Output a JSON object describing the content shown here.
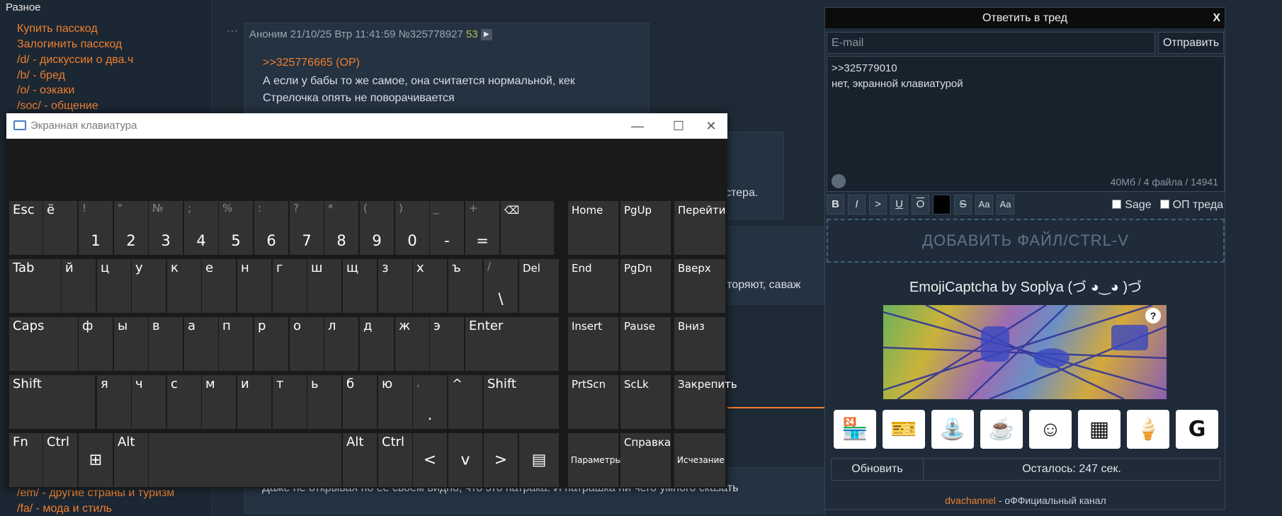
{
  "sidebar": {
    "section_title": "Разное",
    "links": [
      "Купить пасскод",
      "Залогинить пасскод",
      "/d/ - дискуссии о два.ч",
      "/b/ - бред",
      "/o/ - оэкаки",
      "/soc/ - общение"
    ],
    "bottom_links": [
      "/em/ - другие страны и туризм",
      "/fa/ - мода и стиль"
    ]
  },
  "thread": {
    "post": {
      "author": "Аноним",
      "datetime": "21/10/25 Втр 11:41:59",
      "number": "№325778927",
      "count": "53",
      "reply_ref": ">>325776665 (OP)",
      "lines": [
        "А если у бабы то же самое, она считается нормальной, кек",
        "Стрелочка опять не поворачивается"
      ]
    },
    "fragments": {
      "a": "стера.",
      "b": "вторяют, саваж",
      "c": "Даже не открывая по ее своем видно, что это патрака. И патрашка ни чего умного сказать"
    }
  },
  "reply_form": {
    "title": "Ответить в тред",
    "close_label": "X",
    "email_placeholder": "E-mail",
    "send_label": "Отправить",
    "message_lines": [
      ">>325779010",
      "нет, экранной клавиатурой"
    ],
    "meta": "40Мб / 4 файла / 14941",
    "format_buttons": [
      "B",
      "I",
      ">",
      "U",
      "O",
      "",
      "S",
      "Aa",
      "Aa"
    ],
    "sage_label": "Sage",
    "op_label": "ОП треда",
    "add_file_label": "ДОБАВИТЬ ФАЙЛ/CTRL-V",
    "captcha_title": "EmojiCaptcha by Soplya (づ ◕‿◕ )づ",
    "captcha_help": "?",
    "emoji_icons": [
      "shop-icon",
      "ticket-icon",
      "fountain-icon",
      "coffee-icon",
      "face-icon",
      "brick-wall-icon",
      "ice-cream-icon",
      "g-icon"
    ],
    "emoji_glyphs": [
      "🏪",
      "🎫",
      "⛲",
      "☕",
      "☺",
      "▦",
      "🍦",
      "G"
    ],
    "refresh_label": "Обновить",
    "remaining_label": "Осталось: 247 сек.",
    "footer_brand": "dvachannel",
    "footer_rest": " - оФФициальный канал"
  },
  "osk": {
    "title": "Экранная клавиатура",
    "row1": [
      {
        "t": "Esc"
      },
      {
        "t": "ё"
      },
      {
        "s": "!",
        "m": "1"
      },
      {
        "s": "\"",
        "m": "2"
      },
      {
        "s": "№",
        "m": "3"
      },
      {
        "s": ";",
        "m": "4"
      },
      {
        "s": "%",
        "m": "5"
      },
      {
        "s": ":",
        "m": "6"
      },
      {
        "s": "?",
        "m": "7"
      },
      {
        "s": "*",
        "m": "8"
      },
      {
        "s": "(",
        "m": "9"
      },
      {
        "s": ")",
        "m": "0"
      },
      {
        "s": "_",
        "m": "-"
      },
      {
        "s": "+",
        "m": "="
      },
      {
        "t": "⌫"
      }
    ],
    "row2": [
      "Tab",
      "й",
      "ц",
      "у",
      "к",
      "е",
      "н",
      "г",
      "ш",
      "щ",
      "з",
      "х",
      "ъ"
    ],
    "row2_extra": {
      "s": "/",
      "m": "\\",
      "del": "Del"
    },
    "row3": [
      "Caps",
      "ф",
      "ы",
      "в",
      "а",
      "п",
      "р",
      "о",
      "л",
      "д",
      "ж",
      "э",
      "Enter"
    ],
    "row4": [
      "Shift",
      "я",
      "ч",
      "с",
      "м",
      "и",
      "т",
      "ь",
      "б",
      "ю"
    ],
    "row4_extra": {
      "s": ",",
      "m": ".",
      "up": "^",
      "shift": "Shift"
    },
    "row5": [
      "Fn",
      "Ctrl",
      "⊞",
      "Alt",
      "",
      "Alt",
      "Ctrl",
      "<",
      "v",
      ">",
      "▤"
    ],
    "nav": [
      [
        "Home",
        "PgUp",
        "Перейти"
      ],
      [
        "End",
        "PgDn",
        "Вверх"
      ],
      [
        "Insert",
        "Pause",
        "Вниз"
      ],
      [
        "PrtScn",
        "ScLk",
        "Закрепить"
      ],
      [
        "Параметры",
        "Справка",
        "Исчезание"
      ]
    ]
  }
}
